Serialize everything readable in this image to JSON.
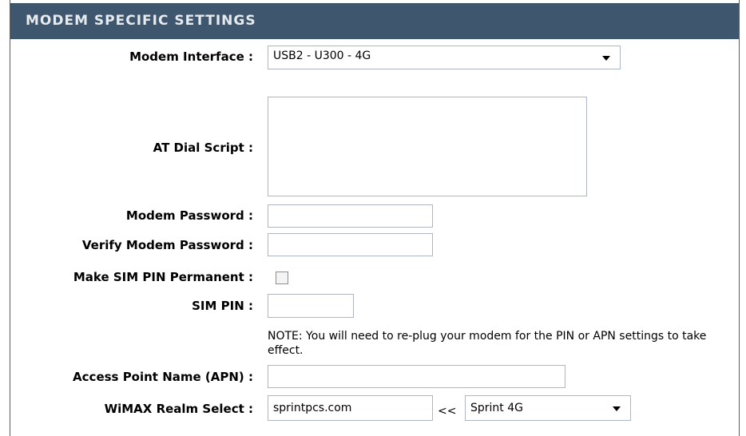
{
  "section": {
    "title": "MODEM SPECIFIC SETTINGS"
  },
  "fields": {
    "modem_interface": {
      "label": "Modem Interface :",
      "value": "USB2 - U300 - 4G"
    },
    "at_dial_script": {
      "label": "AT Dial Script :",
      "value": ""
    },
    "modem_password": {
      "label": "Modem Password :",
      "value": ""
    },
    "verify_modem_password": {
      "label": "Verify Modem Password :",
      "value": ""
    },
    "make_sim_pin_permanent": {
      "label": "Make SIM PIN Permanent :",
      "checked": false
    },
    "sim_pin": {
      "label": "SIM PIN :",
      "value": ""
    },
    "note": "NOTE: You will need to re-plug your modem for the PIN or APN settings to take effect.",
    "apn": {
      "label": "Access Point Name (APN) :",
      "value": ""
    },
    "wimax_realm": {
      "label": "WiMAX Realm Select :",
      "value": "sprintpcs.com",
      "separator": "<<",
      "select_value": "Sprint 4G"
    }
  },
  "colors": {
    "header_bg": "#3e566e",
    "header_text": "#e6ebef",
    "border": "#aeb6bf"
  }
}
